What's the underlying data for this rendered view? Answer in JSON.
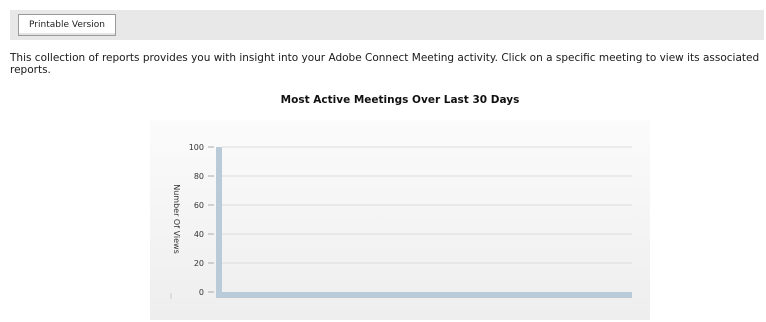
{
  "toolbar": {
    "printable_label": "Printable Version"
  },
  "intro": {
    "text": "This collection of reports provides you with insight into your Adobe Connect Meeting activity. Click on a specific meeting to view its associated reports."
  },
  "chart_data": {
    "type": "bar",
    "title": "Most Active Meetings Over Last 30 Days",
    "ylabel": "Number Of Views",
    "xlabel": "",
    "categories": [],
    "values": [],
    "ylim": [
      0,
      100
    ],
    "yticks": [
      0,
      20,
      40,
      60,
      80,
      100
    ],
    "grid": true,
    "colors": {
      "axis": "#b9cad8",
      "grid": "#dcdcdc",
      "tick_text": "#333333"
    }
  }
}
